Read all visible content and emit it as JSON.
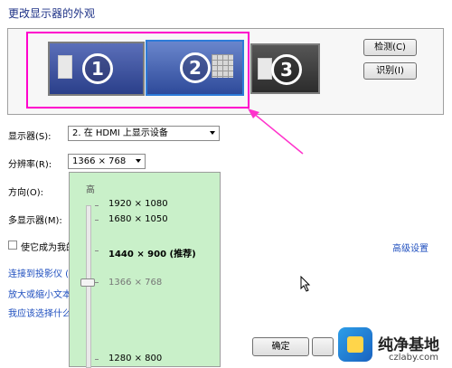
{
  "title": "更改显示器的外观",
  "monitors": [
    {
      "number": "1"
    },
    {
      "number": "2"
    },
    {
      "number": "3"
    }
  ],
  "buttons": {
    "detect": "检测(C)",
    "identify": "识别(I)",
    "ok": "确定"
  },
  "form": {
    "display_label": "显示器(S):",
    "display_value": "2. 在 HDMI 上显示设备",
    "resolution_label": "分辨率(R):",
    "resolution_value": "1366 × 768",
    "orientation_label": "方向(O):",
    "multi_label": "多显示器(M):",
    "make_main_label": "使它成为我的"
  },
  "resolution_popup": {
    "high_label": "高",
    "options": [
      "1920 × 1080",
      "1680 × 1050",
      "1440 × 900 (推荐)",
      "1366 × 768",
      "1280 × 800"
    ],
    "selected": "1366 × 768",
    "recommended": "1440 × 900 (推荐)"
  },
  "links": {
    "advanced": "高级设置",
    "projector": "连接到投影仪 (",
    "text_size": "放大或缩小文本",
    "which": "我应该选择什么"
  },
  "watermark": {
    "name": "纯净基地",
    "url": "czlaby.com"
  },
  "colors": {
    "highlight": "#ff00cc",
    "popup_bg": "#c9f0c9",
    "link": "#1f4fbf"
  }
}
